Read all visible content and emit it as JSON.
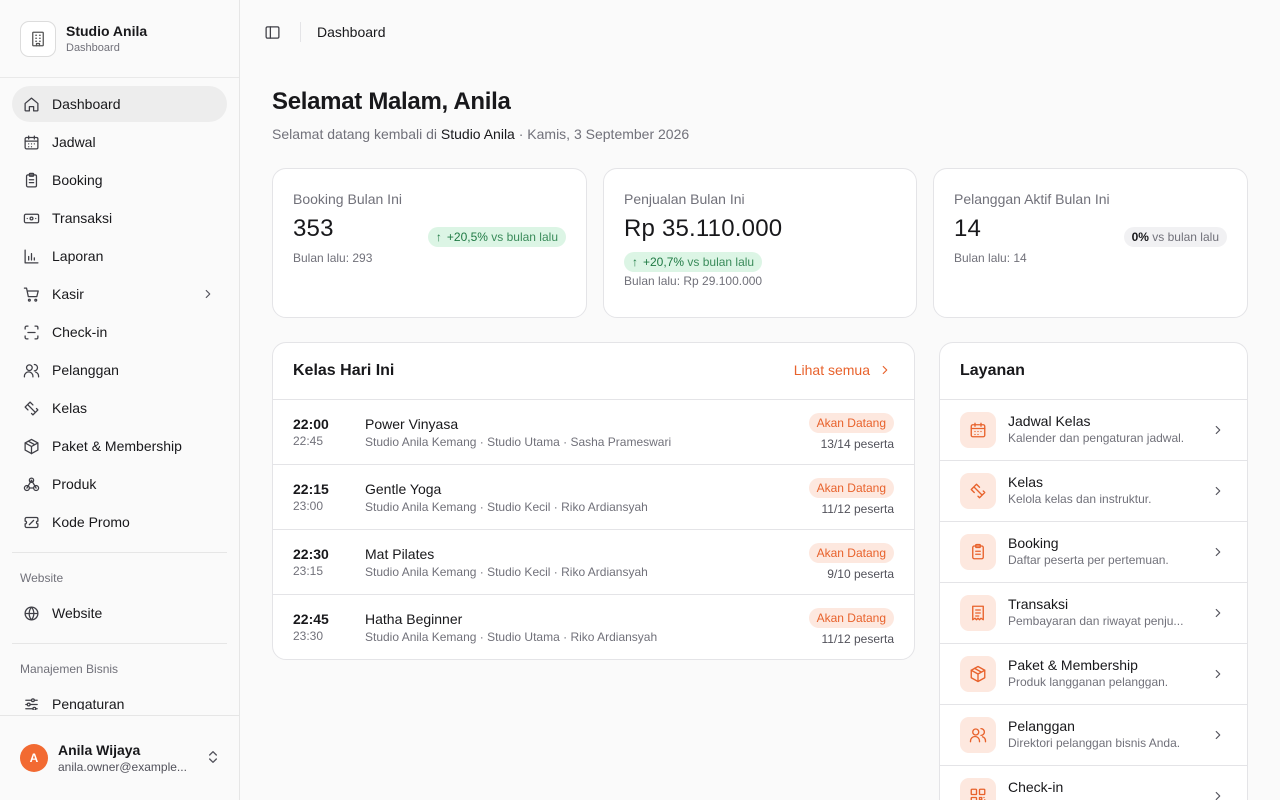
{
  "brand": {
    "name": "Studio Anila",
    "subtitle": "Dashboard",
    "icon": "building-icon"
  },
  "nav": {
    "items": [
      {
        "label": "Dashboard",
        "icon": "home-icon",
        "active": true
      },
      {
        "label": "Jadwal",
        "icon": "calendar-icon"
      },
      {
        "label": "Booking",
        "icon": "clipboard-icon"
      },
      {
        "label": "Transaksi",
        "icon": "banknote-icon"
      },
      {
        "label": "Laporan",
        "icon": "bar-chart-icon"
      },
      {
        "label": "Kasir",
        "icon": "cart-icon",
        "has_submenu": true
      },
      {
        "label": "Check-in",
        "icon": "scan-icon"
      },
      {
        "label": "Pelanggan",
        "icon": "users-icon"
      },
      {
        "label": "Kelas",
        "icon": "dumbbell-icon"
      },
      {
        "label": "Paket & Membership",
        "icon": "package-icon"
      },
      {
        "label": "Produk",
        "icon": "bicycle-icon"
      },
      {
        "label": "Kode Promo",
        "icon": "ticket-icon"
      }
    ],
    "website_section": "Website",
    "website_item": {
      "label": "Website",
      "icon": "globe-icon"
    },
    "business_section": "Manajemen Bisnis",
    "business_item": {
      "label": "Pengaturan",
      "icon": "settings-icon"
    }
  },
  "user": {
    "initial": "A",
    "name": "Anila Wijaya",
    "email": "anila.owner@example..."
  },
  "topbar": {
    "breadcrumb": "Dashboard"
  },
  "greeting": {
    "title": "Selamat Malam, Anila",
    "prefix": "Selamat datang kembali di",
    "studio": "Studio Anila",
    "date": "· Kamis, 3 September 2026"
  },
  "stats": [
    {
      "label": "Booking Bulan Ini",
      "value": "353",
      "change": "+20,5%",
      "change_suffix": "vs bulan lalu",
      "previous": "Bulan lalu: 293",
      "trend": "up"
    },
    {
      "label": "Penjualan Bulan Ini",
      "value": "Rp 35.110.000",
      "change": "+20,7%",
      "change_suffix": "vs bulan lalu",
      "previous": "Bulan lalu: Rp 29.100.000",
      "trend": "up"
    },
    {
      "label": "Pelanggan Aktif Bulan Ini",
      "value": "14",
      "change": "0%",
      "change_suffix": "vs bulan lalu",
      "previous": "Bulan lalu: 14",
      "trend": "flat"
    }
  ],
  "classes": {
    "title": "Kelas Hari Ini",
    "see_all": "Lihat semua",
    "rows": [
      {
        "start": "22:00",
        "end": "22:45",
        "name": "Power Vinyasa",
        "meta": "Studio Anila Kemang · Studio Utama · Sasha Prameswari",
        "status": "Akan Datang",
        "participants": "13/14 peserta"
      },
      {
        "start": "22:15",
        "end": "23:00",
        "name": "Gentle Yoga",
        "meta": "Studio Anila Kemang · Studio Kecil · Riko Ardiansyah",
        "status": "Akan Datang",
        "participants": "11/12 peserta"
      },
      {
        "start": "22:30",
        "end": "23:15",
        "name": "Mat Pilates",
        "meta": "Studio Anila Kemang · Studio Kecil · Riko Ardiansyah",
        "status": "Akan Datang",
        "participants": "9/10 peserta"
      },
      {
        "start": "22:45",
        "end": "23:30",
        "name": "Hatha Beginner",
        "meta": "Studio Anila Kemang · Studio Utama · Riko Ardiansyah",
        "status": "Akan Datang",
        "participants": "11/12 peserta"
      }
    ]
  },
  "services": {
    "title": "Layanan",
    "items": [
      {
        "name": "Jadwal Kelas",
        "desc": "Kalender dan pengaturan jadwal.",
        "icon": "calendar-icon"
      },
      {
        "name": "Kelas",
        "desc": "Kelola kelas dan instruktur.",
        "icon": "dumbbell-icon"
      },
      {
        "name": "Booking",
        "desc": "Daftar peserta per pertemuan.",
        "icon": "clipboard-icon"
      },
      {
        "name": "Transaksi",
        "desc": "Pembayaran dan riwayat penju...",
        "icon": "receipt-icon"
      },
      {
        "name": "Paket & Membership",
        "desc": "Produk langganan pelanggan.",
        "icon": "package-icon"
      },
      {
        "name": "Pelanggan",
        "desc": "Direktori pelanggan bisnis Anda.",
        "icon": "users-icon"
      },
      {
        "name": "Check-in",
        "desc": "",
        "icon": "qr-code-icon"
      }
    ]
  },
  "colors": {
    "accent": "#e8622c",
    "accent_soft": "#fde8df",
    "success_bg": "#dcf5e5",
    "success_text": "#1f7a44",
    "avatar": "#f26a32"
  }
}
